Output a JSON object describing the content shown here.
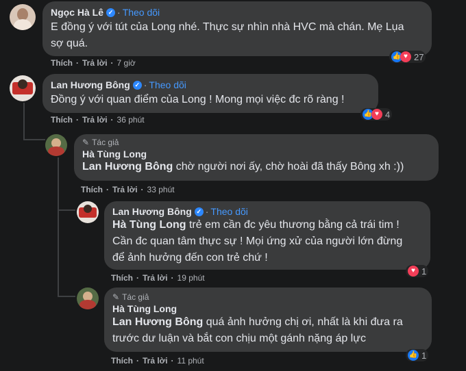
{
  "comments": [
    {
      "name": "Ngọc Hà Lê",
      "follow": "Theo dõi",
      "text": "E đồng ý với tút của Long nhé. Thực sự nhìn nhà HVC mà chán. Mẹ Lụa\nsợ quá.",
      "like": "Thích",
      "reply": "Trả lời",
      "time": "7 giờ",
      "reaction_count": "27"
    },
    {
      "name": "Lan Hương Bông",
      "follow": "Theo dõi",
      "text": "Đồng ý với quan điểm của Long ! Mong mọi việc đc rõ ràng !",
      "like": "Thích",
      "reply": "Trả lời",
      "time": "36 phút",
      "reaction_count": "4"
    },
    {
      "author_tag": "Tác giả",
      "name": "Hà Tùng Long",
      "mention": "Lan Hương Bông",
      "text": " chờ người nơi ấy, chờ hoài đã thấy Bông xh :))",
      "like": "Thích",
      "reply": "Trả lời",
      "time": "33 phút"
    },
    {
      "name": "Lan Hương Bông",
      "follow": "Theo dõi",
      "mention": "Hà Tùng Long",
      "text": " trẻ em cần đc yêu thương bằng cả trái tim !\nCần đc quan tâm thực sự ! Mọi ứng xử của người lớn đừng\nđể ảnh hưởng đến con trẻ chứ !",
      "like": "Thích",
      "reply": "Trả lời",
      "time": "19 phút",
      "reaction_count": "1"
    },
    {
      "author_tag": "Tác giả",
      "name": "Hà Tùng Long",
      "mention": "Lan Hương Bông",
      "text": " quá ảnh hưởng chị ơi, nhất là khi đưa ra\ntrước dư luận và bắt con chịu một gánh nặng áp lực",
      "like": "Thích",
      "reply": "Trả lời",
      "time": "11 phút",
      "reaction_count": "1"
    }
  ],
  "colors": {
    "background": "#18191a",
    "bubble": "#3a3b3c",
    "follow": "#4599ff",
    "like": "#1877f2",
    "love": "#f33e58"
  },
  "icons": [
    "verified-badge-icon",
    "pencil-icon",
    "like-reaction-icon",
    "love-reaction-icon"
  ]
}
